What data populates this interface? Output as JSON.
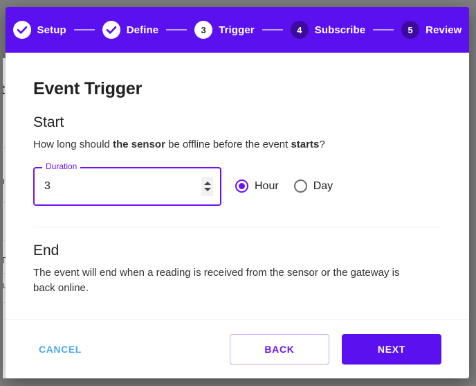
{
  "stepper": {
    "steps": [
      {
        "label": "Setup",
        "marker": "check",
        "state": "done"
      },
      {
        "label": "Define",
        "marker": "check",
        "state": "done"
      },
      {
        "label": "Trigger",
        "marker": "3",
        "state": "active"
      },
      {
        "label": "Subscribe",
        "marker": "4",
        "state": "todo"
      },
      {
        "label": "Review",
        "marker": "5",
        "state": "todo"
      }
    ]
  },
  "dialog": {
    "title": "Event Trigger",
    "start": {
      "heading": "Start",
      "question_prefix": "How long should ",
      "question_bold_1": "the sensor",
      "question_middle": " be offline before the event ",
      "question_bold_2": "starts",
      "question_suffix": "?",
      "duration": {
        "label": "Duration",
        "value": "3",
        "placeholder": ""
      },
      "units": [
        {
          "label": "Hour",
          "selected": true
        },
        {
          "label": "Day",
          "selected": false
        }
      ]
    },
    "end": {
      "heading": "End",
      "description": "The event will end when a reading is received from the sensor or the gateway is back online."
    }
  },
  "footer": {
    "cancel_label": "CANCEL",
    "back_label": "BACK",
    "next_label": "NEXT"
  },
  "colors": {
    "brand_purple": "#5b10f0",
    "accent_purple": "#6c14f0",
    "step_todo": "#3d0aa0",
    "cancel_blue": "#4fa8e8"
  },
  "background": {
    "fragments": [
      "t",
      "D",
      "T",
      "tu"
    ]
  }
}
